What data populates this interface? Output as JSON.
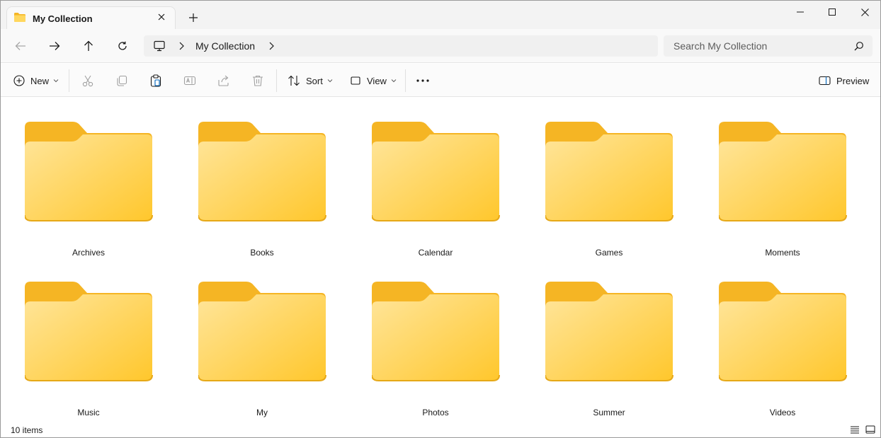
{
  "window": {
    "tab_title": "My Collection",
    "new_tab_symbol": "+"
  },
  "nav": {
    "breadcrumb": [
      "My Collection"
    ],
    "search_placeholder": "Search My Collection"
  },
  "commands": {
    "new_label": "New",
    "sort_label": "Sort",
    "view_label": "View",
    "more_label": "...",
    "preview_label": "Preview"
  },
  "folders": [
    {
      "name": "Archives"
    },
    {
      "name": "Books"
    },
    {
      "name": "Calendar"
    },
    {
      "name": "Games"
    },
    {
      "name": "Moments"
    },
    {
      "name": "Music"
    },
    {
      "name": "My"
    },
    {
      "name": "Photos"
    },
    {
      "name": "Summer"
    },
    {
      "name": "Videos"
    }
  ],
  "status": {
    "item_count": "10 items"
  },
  "icons": {
    "tab": "folder-icon",
    "close": "close-icon",
    "back": "arrow-left-icon",
    "forward": "arrow-right-icon",
    "up": "arrow-up-icon",
    "refresh": "refresh-icon",
    "pc": "monitor-icon",
    "search": "search-icon",
    "cut": "scissors-icon",
    "copy": "copy-icon",
    "paste": "clipboard-icon",
    "rename": "rename-icon",
    "share": "share-icon",
    "delete": "trash-icon",
    "preview": "preview-pane-icon",
    "details_view": "details-view-icon",
    "tiles_view": "tiles-view-icon"
  },
  "colors": {
    "folder_back": "#F5B524",
    "folder_front_light": "#FFE59A",
    "folder_front_dark": "#FFC72C",
    "disabled_icon": "#a0a0a0",
    "accent": "#0067c0"
  }
}
